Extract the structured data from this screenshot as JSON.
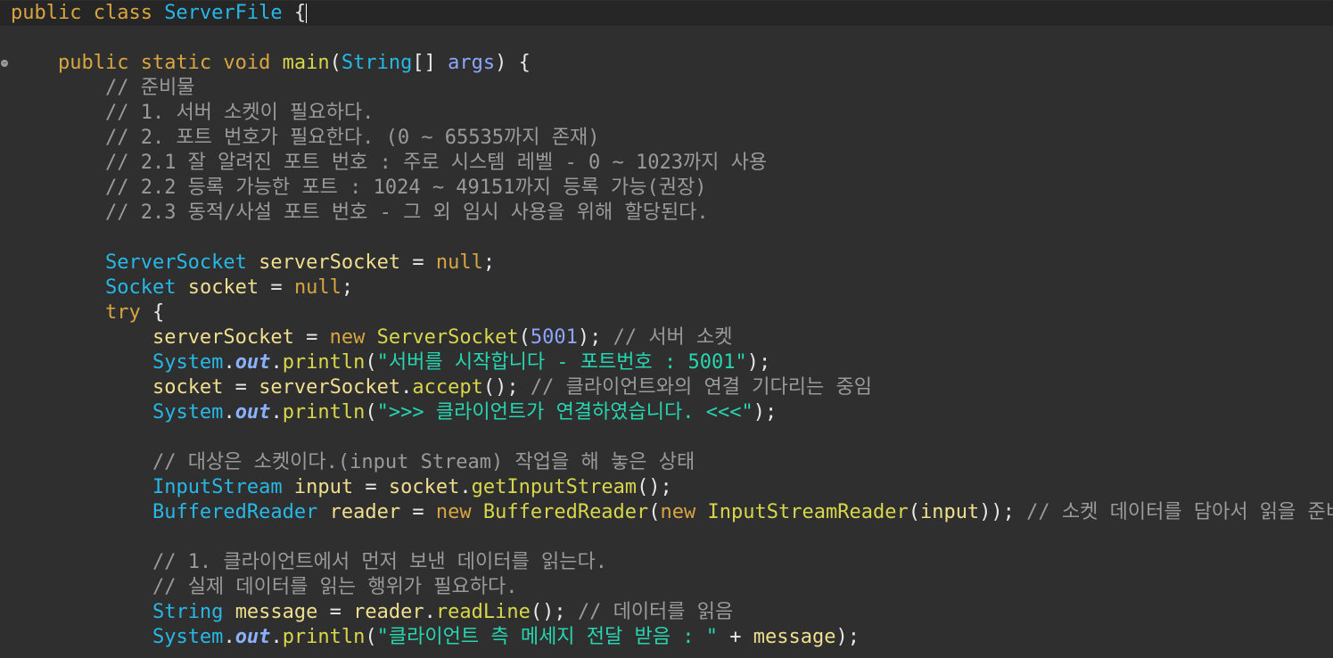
{
  "editor": {
    "language": "Java",
    "colors": {
      "background": "#2f2f2f",
      "current_line": "#262626",
      "keyword": "#d9a540",
      "type": "#27b8e8",
      "method": "#d8d64b",
      "variable": "#f0df8e",
      "comment": "#9a9a9a",
      "string": "#27d6b0",
      "number": "#8da5ff"
    },
    "gutter_marker_icon": "fold-collapse-icon",
    "lines": [
      {
        "indent": "",
        "tokens": [
          {
            "t": "kw",
            "v": "public class "
          },
          {
            "t": "type",
            "v": "ServerFile"
          },
          {
            "t": "punc",
            "v": " {"
          }
        ]
      },
      {
        "indent": "",
        "tokens": []
      },
      {
        "indent": "    ",
        "tokens": [
          {
            "t": "kw",
            "v": "public static void "
          },
          {
            "t": "method",
            "v": "main"
          },
          {
            "t": "punc",
            "v": "("
          },
          {
            "t": "type",
            "v": "String"
          },
          {
            "t": "punc",
            "v": "[] "
          },
          {
            "t": "param",
            "v": "args"
          },
          {
            "t": "punc",
            "v": ") {"
          }
        ]
      },
      {
        "indent": "        ",
        "tokens": [
          {
            "t": "comment",
            "v": "// 준비물"
          }
        ]
      },
      {
        "indent": "        ",
        "tokens": [
          {
            "t": "comment",
            "v": "// 1. 서버 소켓이 필요하다."
          }
        ]
      },
      {
        "indent": "        ",
        "tokens": [
          {
            "t": "comment",
            "v": "// 2. 포트 번호가 필요한다. (0 ~ 65535까지 존재)"
          }
        ]
      },
      {
        "indent": "        ",
        "tokens": [
          {
            "t": "comment",
            "v": "// 2.1 잘 알려진 포트 번호 : 주로 시스템 레벨 - 0 ~ 1023까지 사용"
          }
        ]
      },
      {
        "indent": "        ",
        "tokens": [
          {
            "t": "comment",
            "v": "// 2.2 등록 가능한 포트 : 1024 ~ 49151까지 등록 가능(권장)"
          }
        ]
      },
      {
        "indent": "        ",
        "tokens": [
          {
            "t": "comment",
            "v": "// 2.3 동적/사설 포트 번호 - 그 외 임시 사용을 위해 할당된다."
          }
        ]
      },
      {
        "indent": "",
        "tokens": []
      },
      {
        "indent": "        ",
        "tokens": [
          {
            "t": "type",
            "v": "ServerSocket"
          },
          {
            "t": "punc",
            "v": " "
          },
          {
            "t": "var",
            "v": "serverSocket"
          },
          {
            "t": "punc",
            "v": " = "
          },
          {
            "t": "kw",
            "v": "null"
          },
          {
            "t": "punc",
            "v": ";"
          }
        ]
      },
      {
        "indent": "        ",
        "tokens": [
          {
            "t": "type",
            "v": "Socket"
          },
          {
            "t": "punc",
            "v": " "
          },
          {
            "t": "var",
            "v": "socket"
          },
          {
            "t": "punc",
            "v": " = "
          },
          {
            "t": "kw",
            "v": "null"
          },
          {
            "t": "punc",
            "v": ";"
          }
        ]
      },
      {
        "indent": "        ",
        "tokens": [
          {
            "t": "kw",
            "v": "try"
          },
          {
            "t": "punc",
            "v": " {"
          }
        ]
      },
      {
        "indent": "            ",
        "tokens": [
          {
            "t": "var",
            "v": "serverSocket"
          },
          {
            "t": "punc",
            "v": " = "
          },
          {
            "t": "kw",
            "v": "new "
          },
          {
            "t": "method",
            "v": "ServerSocket"
          },
          {
            "t": "punc",
            "v": "("
          },
          {
            "t": "number",
            "v": "5001"
          },
          {
            "t": "punc",
            "v": "); "
          },
          {
            "t": "comment",
            "v": "// 서버 소켓"
          }
        ]
      },
      {
        "indent": "            ",
        "tokens": [
          {
            "t": "type",
            "v": "System"
          },
          {
            "t": "punc",
            "v": "."
          },
          {
            "t": "field",
            "v": "out"
          },
          {
            "t": "punc",
            "v": "."
          },
          {
            "t": "method",
            "v": "println"
          },
          {
            "t": "punc",
            "v": "("
          },
          {
            "t": "string",
            "v": "\"서버를 시작합니다 - 포트번호 : 5001\""
          },
          {
            "t": "punc",
            "v": ");"
          }
        ]
      },
      {
        "indent": "            ",
        "tokens": [
          {
            "t": "var",
            "v": "socket"
          },
          {
            "t": "punc",
            "v": " = "
          },
          {
            "t": "var",
            "v": "serverSocket"
          },
          {
            "t": "punc",
            "v": "."
          },
          {
            "t": "method",
            "v": "accept"
          },
          {
            "t": "punc",
            "v": "(); "
          },
          {
            "t": "comment",
            "v": "// 클라이언트와의 연결 기다리는 중임"
          }
        ]
      },
      {
        "indent": "            ",
        "tokens": [
          {
            "t": "type",
            "v": "System"
          },
          {
            "t": "punc",
            "v": "."
          },
          {
            "t": "field",
            "v": "out"
          },
          {
            "t": "punc",
            "v": "."
          },
          {
            "t": "method",
            "v": "println"
          },
          {
            "t": "punc",
            "v": "("
          },
          {
            "t": "string",
            "v": "\">>> 클라이언트가 연결하였습니다. <<<\""
          },
          {
            "t": "punc",
            "v": ");"
          }
        ]
      },
      {
        "indent": "",
        "tokens": []
      },
      {
        "indent": "            ",
        "tokens": [
          {
            "t": "comment",
            "v": "// 대상은 소켓이다.(input Stream) 작업을 해 놓은 상태"
          }
        ]
      },
      {
        "indent": "            ",
        "tokens": [
          {
            "t": "type",
            "v": "InputStream"
          },
          {
            "t": "punc",
            "v": " "
          },
          {
            "t": "var",
            "v": "input"
          },
          {
            "t": "punc",
            "v": " = "
          },
          {
            "t": "var",
            "v": "socket"
          },
          {
            "t": "punc",
            "v": "."
          },
          {
            "t": "method",
            "v": "getInputStream"
          },
          {
            "t": "punc",
            "v": "();"
          }
        ]
      },
      {
        "indent": "            ",
        "tokens": [
          {
            "t": "type",
            "v": "BufferedReader"
          },
          {
            "t": "punc",
            "v": " "
          },
          {
            "t": "var",
            "v": "reader"
          },
          {
            "t": "punc",
            "v": " = "
          },
          {
            "t": "kw",
            "v": "new "
          },
          {
            "t": "method",
            "v": "BufferedReader"
          },
          {
            "t": "punc",
            "v": "("
          },
          {
            "t": "kw",
            "v": "new "
          },
          {
            "t": "method",
            "v": "InputStreamReader"
          },
          {
            "t": "punc",
            "v": "("
          },
          {
            "t": "var",
            "v": "input"
          },
          {
            "t": "punc",
            "v": ")); "
          },
          {
            "t": "comment",
            "v": "// 소켓 데이터를 담아서 읽을 준비중임"
          }
        ]
      },
      {
        "indent": "",
        "tokens": []
      },
      {
        "indent": "            ",
        "tokens": [
          {
            "t": "comment",
            "v": "// 1. 클라이언트에서 먼저 보낸 데이터를 읽는다."
          }
        ]
      },
      {
        "indent": "            ",
        "tokens": [
          {
            "t": "comment",
            "v": "// 실제 데이터를 읽는 행위가 필요하다."
          }
        ]
      },
      {
        "indent": "            ",
        "tokens": [
          {
            "t": "type",
            "v": "String"
          },
          {
            "t": "punc",
            "v": " "
          },
          {
            "t": "var",
            "v": "message"
          },
          {
            "t": "punc",
            "v": " = "
          },
          {
            "t": "var",
            "v": "reader"
          },
          {
            "t": "punc",
            "v": "."
          },
          {
            "t": "method",
            "v": "readLine"
          },
          {
            "t": "punc",
            "v": "(); "
          },
          {
            "t": "comment",
            "v": "// 데이터를 읽음"
          }
        ]
      },
      {
        "indent": "            ",
        "tokens": [
          {
            "t": "type",
            "v": "System"
          },
          {
            "t": "punc",
            "v": "."
          },
          {
            "t": "field",
            "v": "out"
          },
          {
            "t": "punc",
            "v": "."
          },
          {
            "t": "method",
            "v": "println"
          },
          {
            "t": "punc",
            "v": "("
          },
          {
            "t": "string",
            "v": "\"클라이언트 측 메세지 전달 받음 : \""
          },
          {
            "t": "punc",
            "v": " + "
          },
          {
            "t": "var",
            "v": "message"
          },
          {
            "t": "punc",
            "v": ");"
          }
        ]
      }
    ]
  }
}
